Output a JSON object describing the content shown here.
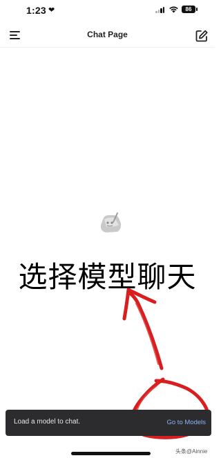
{
  "status_bar": {
    "time": "1:23",
    "battery": "86",
    "icons": [
      "heart-icon",
      "signal-icon",
      "wifi-icon",
      "battery-icon"
    ]
  },
  "header": {
    "title": "Chat Page",
    "left_icon": "menu-icon",
    "right_icon": "edit-icon"
  },
  "main": {
    "prompt_text": "选择模型聊天",
    "center_icon": "model-logo-icon"
  },
  "toast": {
    "message": "Load a model to chat.",
    "action_label": "Go to Models"
  },
  "watermark": "头条@Ainnie",
  "colors": {
    "toast_bg": "#2c2c2e",
    "toast_action": "#8ab4f8",
    "annotation": "#d81e1e"
  }
}
